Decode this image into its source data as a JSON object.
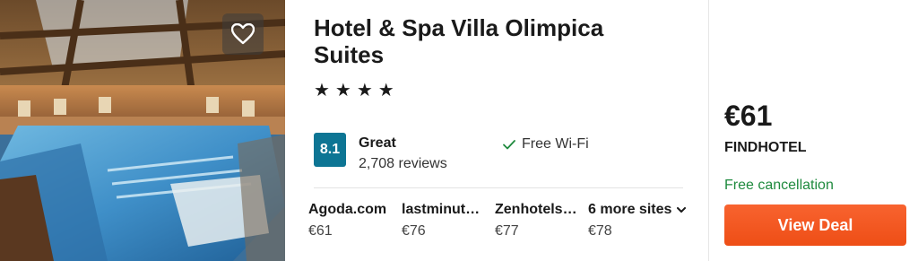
{
  "hotel": {
    "name": "Hotel & Spa Villa Olimpica Suites",
    "stars": "★★★★",
    "rating_score": "8.1",
    "rating_label": "Great",
    "review_count": "2,708 reviews",
    "amenity": "Free Wi-Fi",
    "favorite_icon": "heart-outline-icon"
  },
  "sites": [
    {
      "name": "Agoda.com",
      "price": "€61"
    },
    {
      "name": "lastminute.com",
      "price": "€76"
    },
    {
      "name": "Zenhotels.com",
      "price": "€77"
    }
  ],
  "more_sites": {
    "label": "6 more sites",
    "price": "€78",
    "icon": "chevron-down-icon"
  },
  "deal": {
    "price": "€61",
    "provider": "FINDHOTEL",
    "cancellation": "Free cancellation",
    "button_label": "View Deal"
  },
  "colors": {
    "rating_badge": "#0d7594",
    "cancellation_text": "#1f8a3e",
    "deal_button": "#f25a22"
  }
}
